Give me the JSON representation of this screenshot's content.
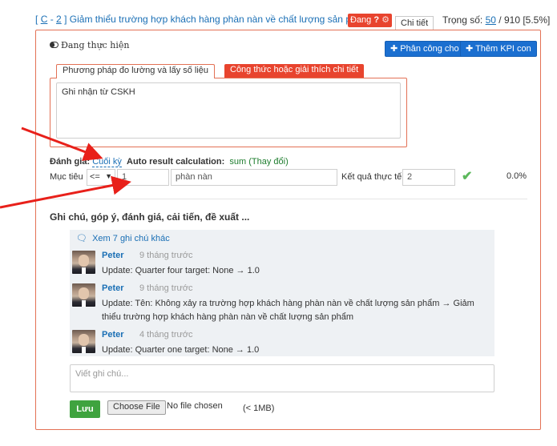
{
  "header": {
    "open_bracket": "[",
    "code_part1": "C",
    "separator": "-",
    "code_part2": "2",
    "close_bracket": "]",
    "kpi_title": "Giảm thiểu trường hợp khách hàng phàn nàn về chất lượng sản phẩm",
    "badge": "Đang",
    "tab_detail": "Chi tiết",
    "weight_label": "Trọng số:",
    "weight_value": "50",
    "weight_total": "/ 910 [5.5%]"
  },
  "status": {
    "label": "Đang thực hiện"
  },
  "actions": {
    "assign_label": "Phân công cho",
    "add_kpi_label": "Thêm KPI con"
  },
  "method": {
    "tab_method": "Phương pháp đo lường và lấy số liệu",
    "tab_formula": "Công thức hoặc giải thích chi tiết",
    "text": "Ghi nhận từ CSKH"
  },
  "evaluation": {
    "label": "Đánh giá:",
    "period": "Cuối kỳ",
    "auto_label": "Auto result calculation:",
    "method": "sum",
    "change": "(Thay đổi)"
  },
  "target": {
    "label": "Mục tiêu",
    "operator": "<=",
    "value": "1",
    "unit": "phàn nàn",
    "actual_label": "Kết quả thực tế",
    "actual_value": "2",
    "percent": "0.0%"
  },
  "notes": {
    "title": "Ghi chú, góp ý, đánh giá, cải tiến, đề xuất ...",
    "see_more": "Xem 7 ghi chú khác",
    "items": [
      {
        "author": "Peter",
        "time": "9 tháng trước",
        "text": "Update: Quarter four target: None → 1.0"
      },
      {
        "author": "Peter",
        "time": "9 tháng trước",
        "text": "Update: Tên: Không xảy ra trường hợp khách hàng phàn nàn về chất lượng sản phẩm → Giảm thiểu trường hợp khách hàng phàn nàn về chất lượng sản phẩm"
      },
      {
        "author": "Peter",
        "time": "4 tháng trước",
        "text": "Update: Quarter one target: None → 1.0"
      }
    ],
    "comment_placeholder": "Viết ghi chú...",
    "save_label": "Lưu",
    "choose_file": "Choose File",
    "file_status": "No file chosen",
    "size_limit": "(< 1MB)"
  },
  "colors": {
    "accent_red": "#e8442e",
    "primary_blue": "#1b6fd0",
    "save_green": "#3fa33f",
    "annotation_arrow": "#e8201a"
  },
  "icons": [
    "toggle-icon",
    "plus-icon",
    "help-icon",
    "gear-icon",
    "comment-icon",
    "check-icon",
    "caret-down-icon"
  ]
}
